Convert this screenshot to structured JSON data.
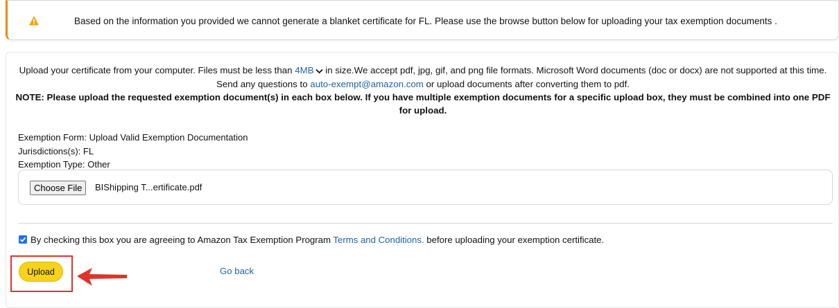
{
  "alert": {
    "icon": "warning-icon",
    "icon_color": "#f0a60c",
    "message": "Based on the information you provided we cannot generate a blanket certificate for FL. Please use the browse button below for uploading your tax exemption documents ."
  },
  "instructions": {
    "part1": "Upload your certificate from your computer. Files must be less than ",
    "size_link": "4MB",
    "part2": " in size.We accept pdf, jpg, gif, and png file formats. Microsoft Word documents (doc or docx) are not supported at this time. Send any questions to ",
    "email_link": "auto-exempt@amazon.com",
    "part3": " or upload documents after converting them to pdf.",
    "note": "NOTE: Please upload the requested exemption document(s) in each box below. If you have multiple exemption documents for a specific upload box, they must be combined into one PDF for upload."
  },
  "exemption": {
    "form_label": "Exemption Form:",
    "form_value": "Upload Valid Exemption Documentation",
    "jurisdiction_label": "Jurisdictions(s):",
    "jurisdiction_value": "FL",
    "type_label": "Exemption Type:",
    "type_value": "Other"
  },
  "file_input": {
    "button_label": "Choose File",
    "file_name": "BIShipping T...ertificate.pdf"
  },
  "agreement": {
    "checked": true,
    "text_before": "By checking this box you are agreeing to Amazon Tax Exemption Program ",
    "terms_link": "Terms and Conditions.",
    "text_after": " before uploading your exemption certificate."
  },
  "actions": {
    "upload_label": "Upload",
    "go_back_label": "Go back"
  },
  "colors": {
    "accent_orange": "#f08804",
    "button_yellow": "#f7d21a",
    "link_blue": "#2162a1",
    "annotation_red": "#e0332b"
  }
}
